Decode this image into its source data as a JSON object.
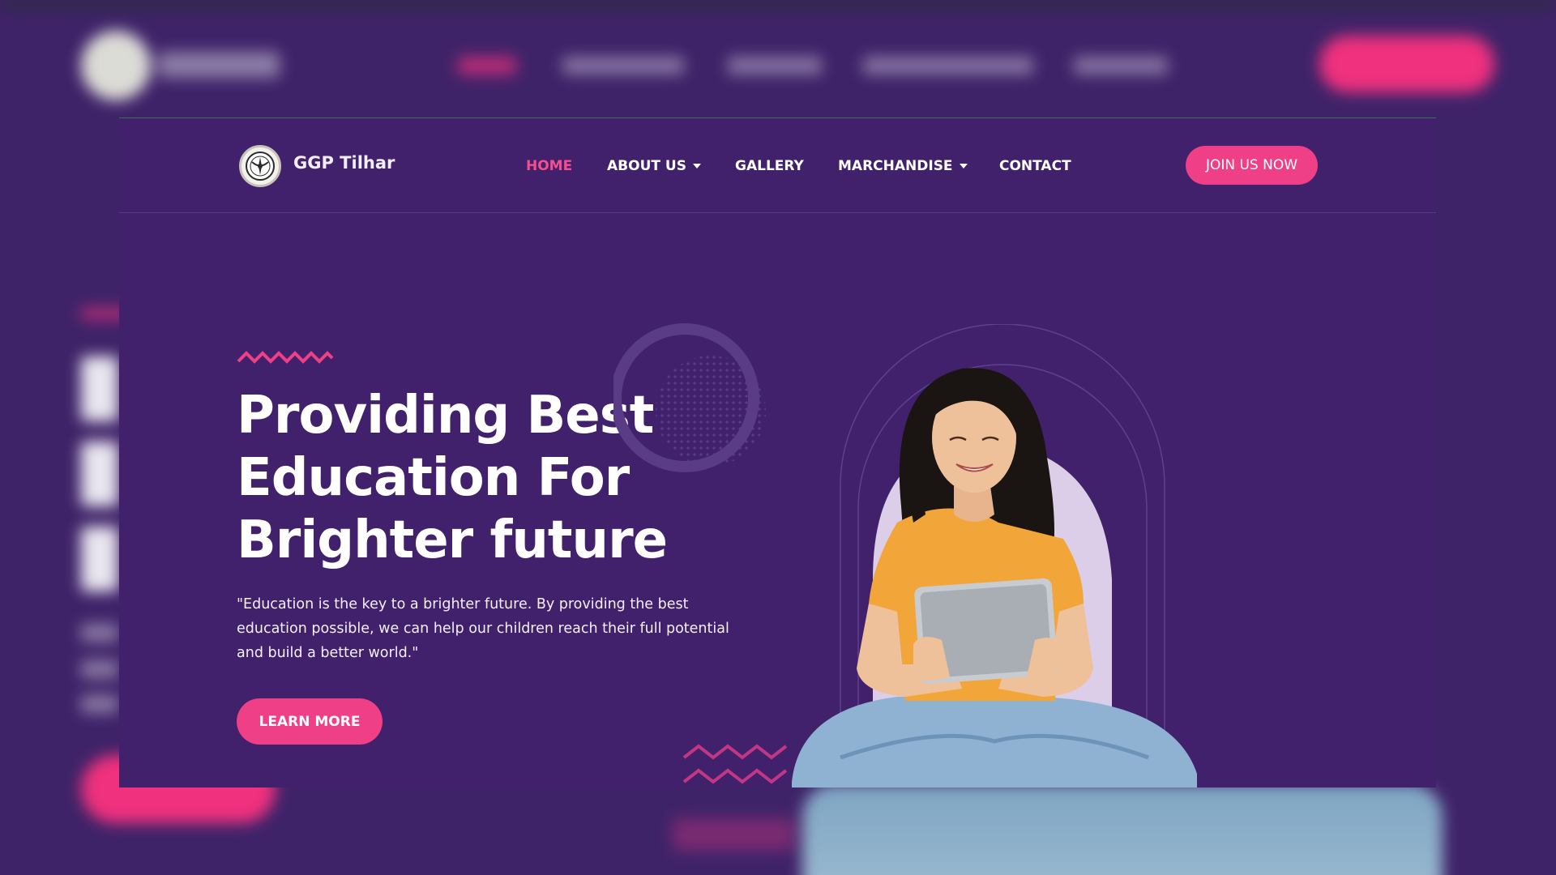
{
  "header": {
    "brand": "GGP Tilhar",
    "nav": [
      {
        "label": "HOME",
        "active": true,
        "dropdown": false
      },
      {
        "label": "ABOUT US",
        "active": false,
        "dropdown": true
      },
      {
        "label": "GALLERY",
        "active": false,
        "dropdown": false
      },
      {
        "label": "MARCHANDISE",
        "active": false,
        "dropdown": true
      },
      {
        "label": "CONTACT",
        "active": false,
        "dropdown": false
      }
    ],
    "join_label": "JOIN US NOW"
  },
  "hero": {
    "title_line1": "Providing Best",
    "title_line2": "Education For",
    "title_line3": "Brighter future",
    "description": "\"Education is the key to a brighter future. By providing the best education possible, we can help our children reach their full potential and build a better world.\"",
    "cta_label": "LEARN MORE"
  },
  "colors": {
    "background": "#3f2369",
    "accent_pink": "#ef3f86",
    "active_nav": "#f54e8c",
    "text": "#ffffff"
  },
  "icons": {
    "logo": "emblem-logo-icon",
    "dropdown": "caret-down-icon"
  }
}
